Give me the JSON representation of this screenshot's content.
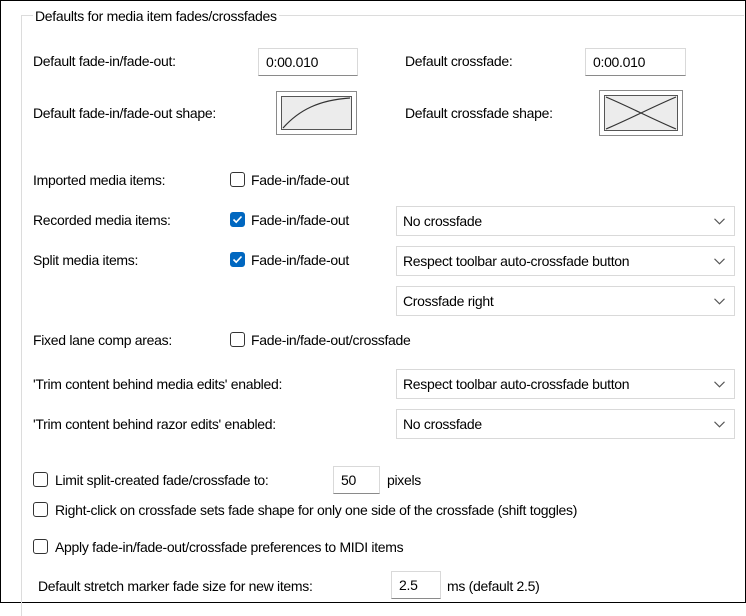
{
  "group": {
    "title": "Defaults for media item fades/crossfades"
  },
  "fade_default": {
    "label": "Default fade-in/fade-out:",
    "value": "0:00.010"
  },
  "crossfade_default": {
    "label": "Default crossfade:",
    "value": "0:00.010"
  },
  "fade_shape": {
    "label": "Default fade-in/fade-out shape:"
  },
  "crossfade_shape": {
    "label": "Default crossfade shape:"
  },
  "imported": {
    "label": "Imported media items:",
    "checkbox_label": "Fade-in/fade-out",
    "checked": false
  },
  "recorded": {
    "label": "Recorded media items:",
    "checkbox_label": "Fade-in/fade-out",
    "checked": true,
    "select": "No crossfade"
  },
  "split": {
    "label": "Split media items:",
    "checkbox_label": "Fade-in/fade-out",
    "checked": true,
    "select": "Respect toolbar auto-crossfade button",
    "select2": "Crossfade right"
  },
  "fixed_lane": {
    "label": "Fixed lane comp areas:",
    "checkbox_label": "Fade-in/fade-out/crossfade",
    "checked": false
  },
  "trim_media": {
    "label": "'Trim content behind media edits' enabled:",
    "select": "Respect toolbar auto-crossfade button"
  },
  "trim_razor": {
    "label": "'Trim content behind razor edits' enabled:",
    "select": "No crossfade"
  },
  "limit_split": {
    "label": "Limit split-created fade/crossfade to:",
    "value": "50",
    "unit": "pixels",
    "checked": false
  },
  "right_click": {
    "label": "Right-click on crossfade sets fade shape for only one side of the crossfade (shift toggles)",
    "checked": false
  },
  "apply_midi": {
    "label": "Apply fade-in/fade-out/crossfade preferences to MIDI items",
    "checked": false
  },
  "stretch_marker": {
    "label": "Default stretch marker fade size for new items:",
    "value": "2.5",
    "unit": "ms (default 2.5)"
  },
  "colors": {
    "accent": "#0067c0",
    "border": "#d9d9d9"
  }
}
